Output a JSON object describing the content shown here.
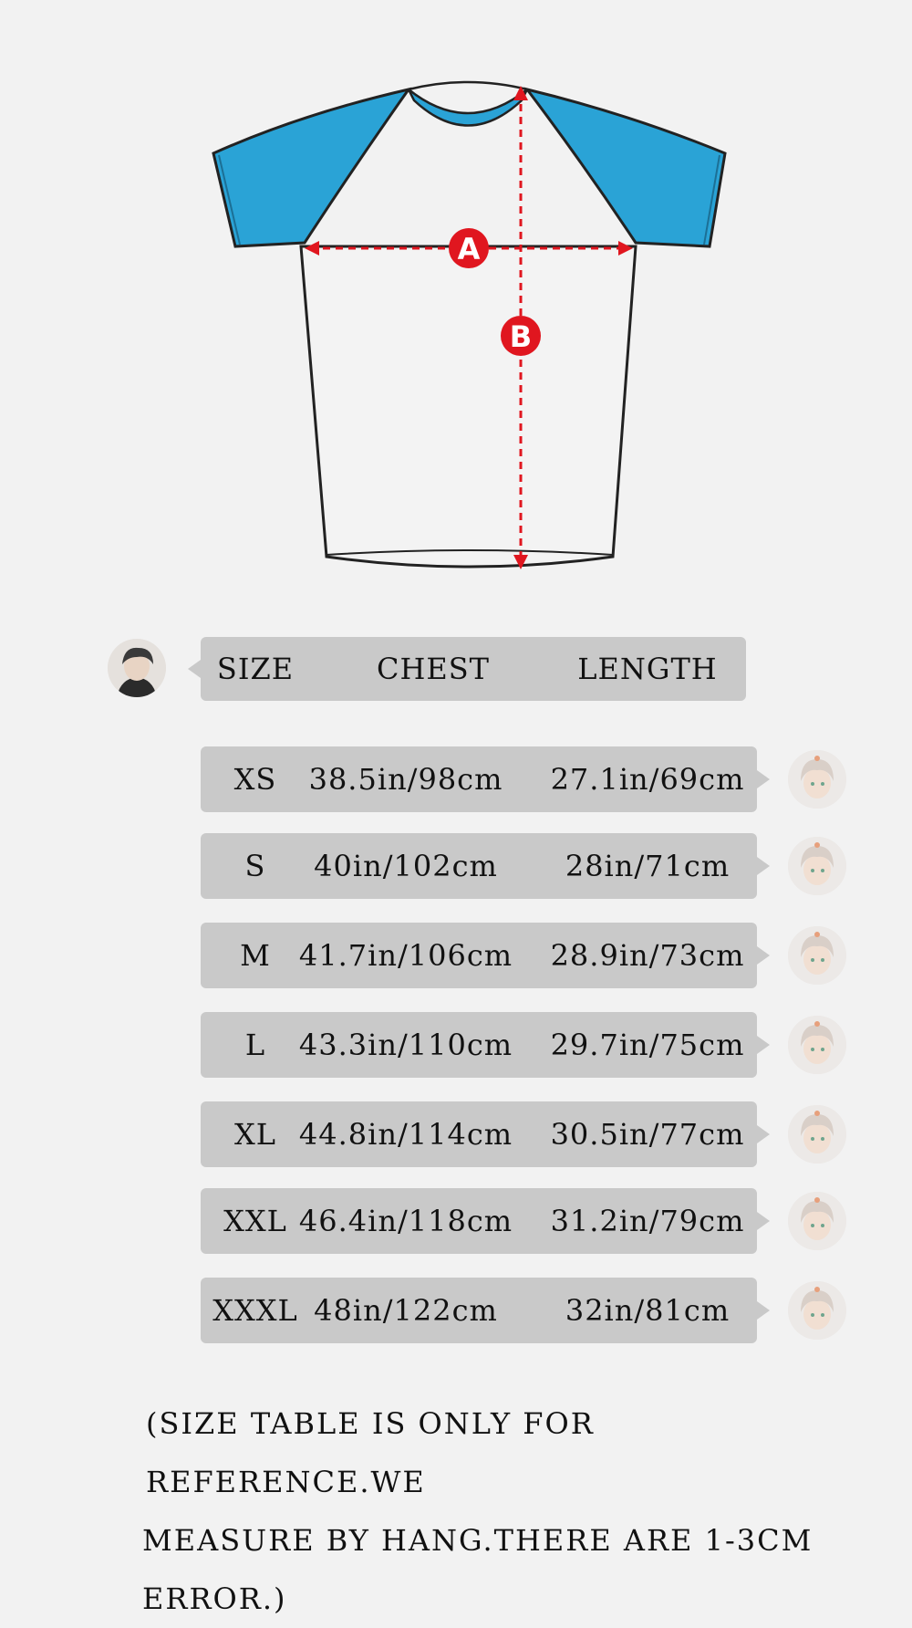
{
  "diagram": {
    "marker_a": "A",
    "marker_b": "B",
    "sleeve_color": "#2aa3d6",
    "arrow_color": "#e0161f"
  },
  "header": {
    "size": "SIZE",
    "chest": "CHEST",
    "length": "LENGTH"
  },
  "rows": [
    {
      "size": "XS",
      "chest": "38.5in/98cm",
      "length": "27.1in/69cm"
    },
    {
      "size": "S",
      "chest": "40in/102cm",
      "length": "28in/71cm"
    },
    {
      "size": "M",
      "chest": "41.7in/106cm",
      "length": "28.9in/73cm"
    },
    {
      "size": "L",
      "chest": "43.3in/110cm",
      "length": "29.7in/75cm"
    },
    {
      "size": "XL",
      "chest": "44.8in/114cm",
      "length": "30.5in/77cm"
    },
    {
      "size": "XXL",
      "chest": "46.4in/118cm",
      "length": "31.2in/79cm"
    },
    {
      "size": "XXXL",
      "chest": "48in/122cm",
      "length": "32in/81cm"
    }
  ],
  "note": {
    "line1": "(SIZE TABLE IS ONLY FOR REFERENCE.WE",
    "line2": "MEASURE BY HANG.THERE ARE 1-3CM ERROR.)"
  }
}
